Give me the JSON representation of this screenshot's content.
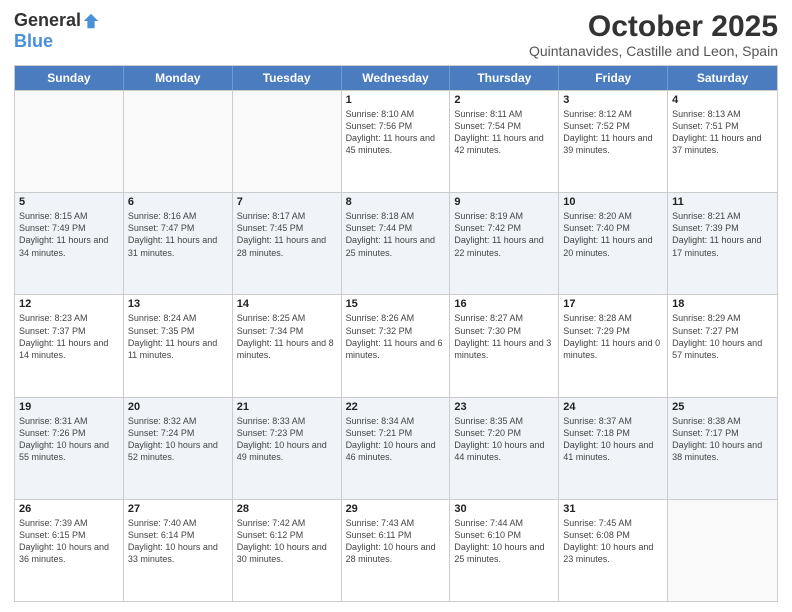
{
  "header": {
    "logo_general": "General",
    "logo_blue": "Blue",
    "month_title": "October 2025",
    "location": "Quintanavides, Castille and Leon, Spain"
  },
  "days_of_week": [
    "Sunday",
    "Monday",
    "Tuesday",
    "Wednesday",
    "Thursday",
    "Friday",
    "Saturday"
  ],
  "weeks": [
    [
      {
        "day": "",
        "info": ""
      },
      {
        "day": "",
        "info": ""
      },
      {
        "day": "",
        "info": ""
      },
      {
        "day": "1",
        "info": "Sunrise: 8:10 AM\nSunset: 7:56 PM\nDaylight: 11 hours and 45 minutes."
      },
      {
        "day": "2",
        "info": "Sunrise: 8:11 AM\nSunset: 7:54 PM\nDaylight: 11 hours and 42 minutes."
      },
      {
        "day": "3",
        "info": "Sunrise: 8:12 AM\nSunset: 7:52 PM\nDaylight: 11 hours and 39 minutes."
      },
      {
        "day": "4",
        "info": "Sunrise: 8:13 AM\nSunset: 7:51 PM\nDaylight: 11 hours and 37 minutes."
      }
    ],
    [
      {
        "day": "5",
        "info": "Sunrise: 8:15 AM\nSunset: 7:49 PM\nDaylight: 11 hours and 34 minutes."
      },
      {
        "day": "6",
        "info": "Sunrise: 8:16 AM\nSunset: 7:47 PM\nDaylight: 11 hours and 31 minutes."
      },
      {
        "day": "7",
        "info": "Sunrise: 8:17 AM\nSunset: 7:45 PM\nDaylight: 11 hours and 28 minutes."
      },
      {
        "day": "8",
        "info": "Sunrise: 8:18 AM\nSunset: 7:44 PM\nDaylight: 11 hours and 25 minutes."
      },
      {
        "day": "9",
        "info": "Sunrise: 8:19 AM\nSunset: 7:42 PM\nDaylight: 11 hours and 22 minutes."
      },
      {
        "day": "10",
        "info": "Sunrise: 8:20 AM\nSunset: 7:40 PM\nDaylight: 11 hours and 20 minutes."
      },
      {
        "day": "11",
        "info": "Sunrise: 8:21 AM\nSunset: 7:39 PM\nDaylight: 11 hours and 17 minutes."
      }
    ],
    [
      {
        "day": "12",
        "info": "Sunrise: 8:23 AM\nSunset: 7:37 PM\nDaylight: 11 hours and 14 minutes."
      },
      {
        "day": "13",
        "info": "Sunrise: 8:24 AM\nSunset: 7:35 PM\nDaylight: 11 hours and 11 minutes."
      },
      {
        "day": "14",
        "info": "Sunrise: 8:25 AM\nSunset: 7:34 PM\nDaylight: 11 hours and 8 minutes."
      },
      {
        "day": "15",
        "info": "Sunrise: 8:26 AM\nSunset: 7:32 PM\nDaylight: 11 hours and 6 minutes."
      },
      {
        "day": "16",
        "info": "Sunrise: 8:27 AM\nSunset: 7:30 PM\nDaylight: 11 hours and 3 minutes."
      },
      {
        "day": "17",
        "info": "Sunrise: 8:28 AM\nSunset: 7:29 PM\nDaylight: 11 hours and 0 minutes."
      },
      {
        "day": "18",
        "info": "Sunrise: 8:29 AM\nSunset: 7:27 PM\nDaylight: 10 hours and 57 minutes."
      }
    ],
    [
      {
        "day": "19",
        "info": "Sunrise: 8:31 AM\nSunset: 7:26 PM\nDaylight: 10 hours and 55 minutes."
      },
      {
        "day": "20",
        "info": "Sunrise: 8:32 AM\nSunset: 7:24 PM\nDaylight: 10 hours and 52 minutes."
      },
      {
        "day": "21",
        "info": "Sunrise: 8:33 AM\nSunset: 7:23 PM\nDaylight: 10 hours and 49 minutes."
      },
      {
        "day": "22",
        "info": "Sunrise: 8:34 AM\nSunset: 7:21 PM\nDaylight: 10 hours and 46 minutes."
      },
      {
        "day": "23",
        "info": "Sunrise: 8:35 AM\nSunset: 7:20 PM\nDaylight: 10 hours and 44 minutes."
      },
      {
        "day": "24",
        "info": "Sunrise: 8:37 AM\nSunset: 7:18 PM\nDaylight: 10 hours and 41 minutes."
      },
      {
        "day": "25",
        "info": "Sunrise: 8:38 AM\nSunset: 7:17 PM\nDaylight: 10 hours and 38 minutes."
      }
    ],
    [
      {
        "day": "26",
        "info": "Sunrise: 7:39 AM\nSunset: 6:15 PM\nDaylight: 10 hours and 36 minutes."
      },
      {
        "day": "27",
        "info": "Sunrise: 7:40 AM\nSunset: 6:14 PM\nDaylight: 10 hours and 33 minutes."
      },
      {
        "day": "28",
        "info": "Sunrise: 7:42 AM\nSunset: 6:12 PM\nDaylight: 10 hours and 30 minutes."
      },
      {
        "day": "29",
        "info": "Sunrise: 7:43 AM\nSunset: 6:11 PM\nDaylight: 10 hours and 28 minutes."
      },
      {
        "day": "30",
        "info": "Sunrise: 7:44 AM\nSunset: 6:10 PM\nDaylight: 10 hours and 25 minutes."
      },
      {
        "day": "31",
        "info": "Sunrise: 7:45 AM\nSunset: 6:08 PM\nDaylight: 10 hours and 23 minutes."
      },
      {
        "day": "",
        "info": ""
      }
    ]
  ]
}
